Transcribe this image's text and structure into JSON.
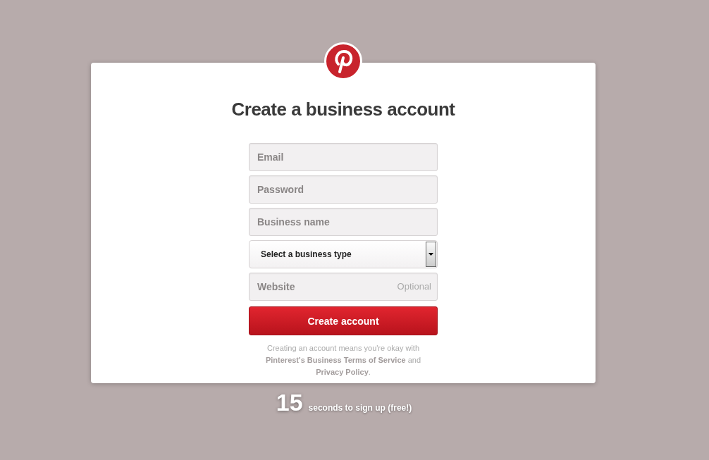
{
  "title": "Create a business account",
  "fields": [
    {
      "kind": "input",
      "placeholder": "Email"
    },
    {
      "kind": "input",
      "placeholder": "Password"
    },
    {
      "kind": "input",
      "placeholder": "Business name"
    },
    {
      "kind": "select",
      "value": "Select a business type"
    },
    {
      "kind": "input",
      "placeholder": "Website",
      "hint": "Optional"
    }
  ],
  "submit_button": "Create account",
  "terms": [
    {
      "kind": "text",
      "text": "Creating an account means you're okay with "
    },
    {
      "kind": "link",
      "text": "Pinterest's Business Terms of Service"
    },
    {
      "kind": "text",
      "text": " and "
    },
    {
      "kind": "link",
      "text": "Privacy Policy"
    },
    {
      "kind": "text",
      "text": "."
    }
  ],
  "footer": {
    "number": "15",
    "text": "seconds to sign up (free!)"
  }
}
